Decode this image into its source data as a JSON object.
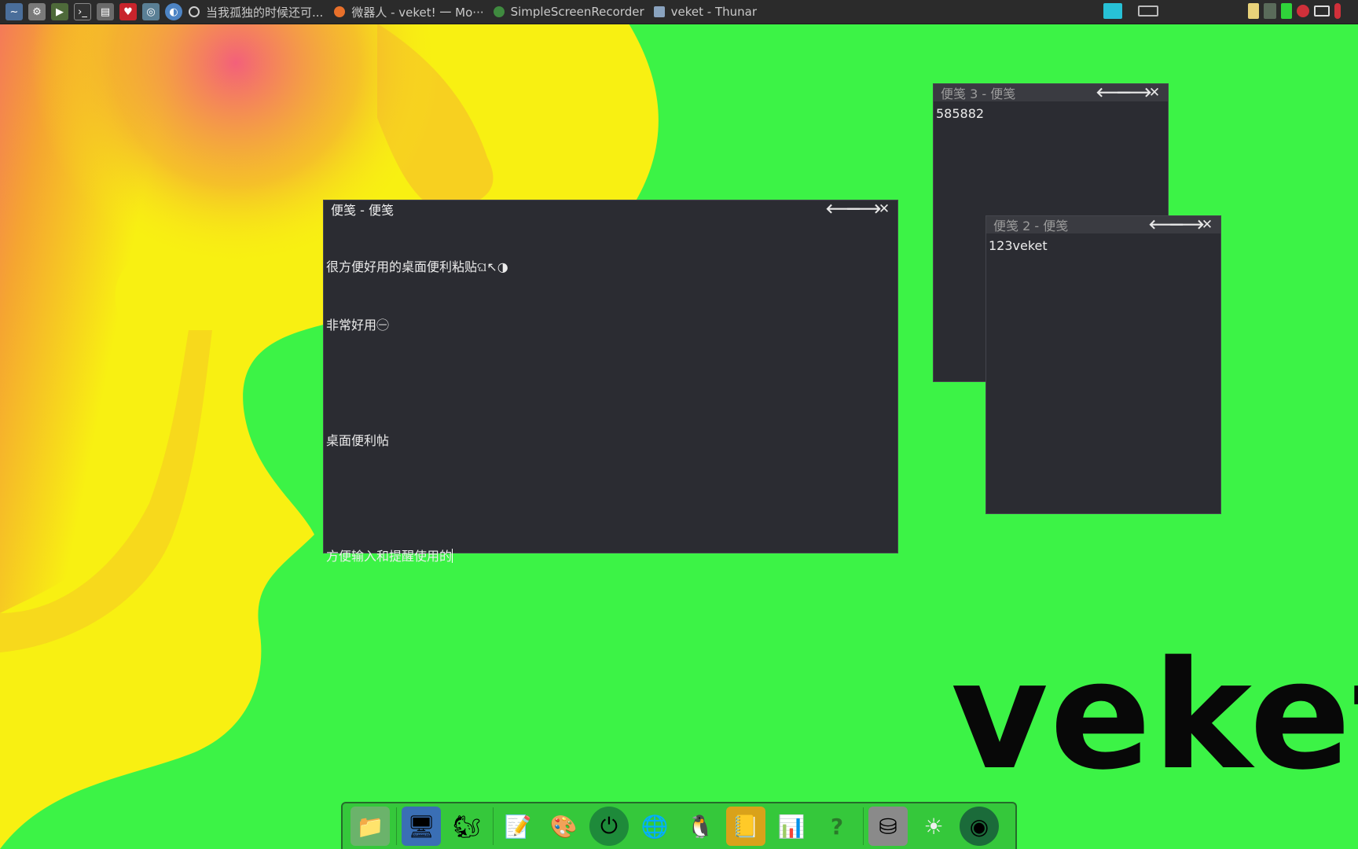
{
  "panel": {
    "tasks": [
      {
        "label": "当我孤独的时候还可...",
        "icon": "circle-icon",
        "color": "#cfcfcf"
      },
      {
        "label": "微器人 - veket! 一 Mo···",
        "icon": "firefox-icon",
        "color": "#e8702a"
      },
      {
        "label": "SimpleScreenRecorder",
        "icon": "recorder-icon",
        "color": "#3f8a3f"
      },
      {
        "label": "veket - Thunar",
        "icon": "folder-icon",
        "color": "#8aa3bf"
      }
    ]
  },
  "notes": {
    "main": {
      "title": "便笺 - 便笺",
      "lines": [
        "很方便好用的桌面便利粘贴ଘ↖◑",
        "非常好用㊀",
        "",
        "桌面便利帖",
        "",
        "方便输入和提醒使用的"
      ]
    },
    "note3": {
      "title": "便笺 3 - 便笺",
      "text": "585882"
    },
    "note2": {
      "title": "便笺 2 - 便笺",
      "text": "123veket"
    },
    "buttons": {
      "prev": "🡐",
      "next": "🡒",
      "close": "✕"
    }
  },
  "desktop": {
    "brand_text": "veket"
  },
  "colors": {
    "wallpaper_green": "#3cf346",
    "wallpaper_yellow": "#f7f311",
    "wallpaper_orange": "#f5a030",
    "note_bg": "#2b2c32"
  }
}
